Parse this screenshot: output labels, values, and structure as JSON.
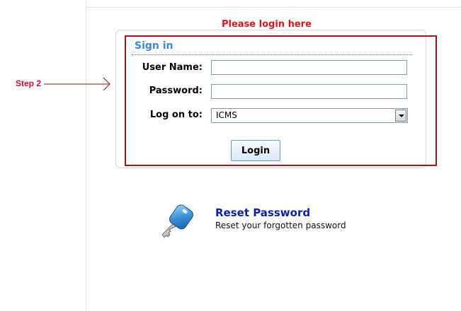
{
  "annotation": {
    "step_label": "Step 2",
    "highlight_color": "#9e1a1a"
  },
  "header": {
    "prompt": "Please login here"
  },
  "login_form": {
    "title": "Sign in",
    "username_label": "User Name:",
    "username_value": "",
    "password_label": "Password:",
    "password_value": "",
    "logon_label": "Log on to:",
    "logon_selected": "ICMS",
    "submit_label": "Login"
  },
  "reset": {
    "icon": "key-icon",
    "title": "Reset Password",
    "description": "Reset your forgotten password"
  },
  "colors": {
    "prompt": "#e2141b",
    "sign_in_title": "#3f86d6",
    "reset_link": "#0b1fa8"
  }
}
